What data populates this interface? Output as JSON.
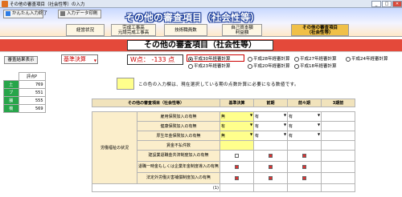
{
  "window": {
    "title": "その他の審査項目（社会性等）の入力"
  },
  "toolbar": {
    "back_label": "かんたん入力終了",
    "print_label": "入力データ印刷"
  },
  "header": {
    "title": "その他の審査項目（社会性等）"
  },
  "nav": [
    {
      "label": "経営状況"
    },
    {
      "label": "完成工事高\n元請完成工事高"
    },
    {
      "label": "技術職員数"
    },
    {
      "label": "自己資本額\n利益額"
    },
    {
      "label": "その他の審査項目\n（社会性等）"
    }
  ],
  "section_title": "その他の審査項目（社会性等）",
  "controls": {
    "display_button": "審査結果表示",
    "basis_select": "基準決算",
    "w_points": "W点： -133 点",
    "radios": [
      {
        "label": "平成30年経審計算",
        "selected": true
      },
      {
        "label": "平成28年経審計算",
        "selected": false
      },
      {
        "label": "平成27年経審計算",
        "selected": false
      },
      {
        "label": "平成24年経審計算",
        "selected": false
      },
      {
        "label": "平成23年経審計算",
        "selected": false
      },
      {
        "label": "平成20年経審計算",
        "selected": false
      },
      {
        "label": "平成18年経審計算",
        "selected": false
      }
    ]
  },
  "note": "この色の入力欄は、現在選択している期の点数計算に必要になる数値です。",
  "score_table": {
    "header": "評点P",
    "rows": [
      {
        "label": "土",
        "value": "769"
      },
      {
        "label": "ブ",
        "value": "551"
      },
      {
        "label": "舗",
        "value": "555"
      },
      {
        "label": "機",
        "value": "569"
      }
    ]
  },
  "colors": {
    "accent_red": "#e4493a",
    "input_yellow": "#ffff8c",
    "active_tab": "#f0c048"
  },
  "grid": {
    "headers": [
      "その他の審査項目（社会性等）",
      "基準決算",
      "前期",
      "前々期",
      "3期前"
    ],
    "group_label": "労働福祉の状況",
    "rows": [
      {
        "label": "雇用保険加入の有無",
        "v": [
          "無",
          "有",
          "有"
        ]
      },
      {
        "label": "健康保険加入の有無",
        "v": [
          "有",
          "有",
          "有"
        ]
      },
      {
        "label": "厚生年金保険加入の有無",
        "v": [
          "無",
          "有",
          "有"
        ]
      },
      {
        "label": "賃金不払件数",
        "v": [
          "",
          "",
          ""
        ]
      },
      {
        "label": "建設業退職金共済制度加入の有無",
        "v": [
          "",
          "",
          ""
        ]
      },
      {
        "label": "退職一時金もしくは企業年金制度導入の有無",
        "v": [
          "",
          "",
          ""
        ]
      },
      {
        "label": "法定外労働災害補償制度加入の有無",
        "v": [
          "",
          "",
          ""
        ]
      }
    ],
    "footer": "(1)"
  }
}
